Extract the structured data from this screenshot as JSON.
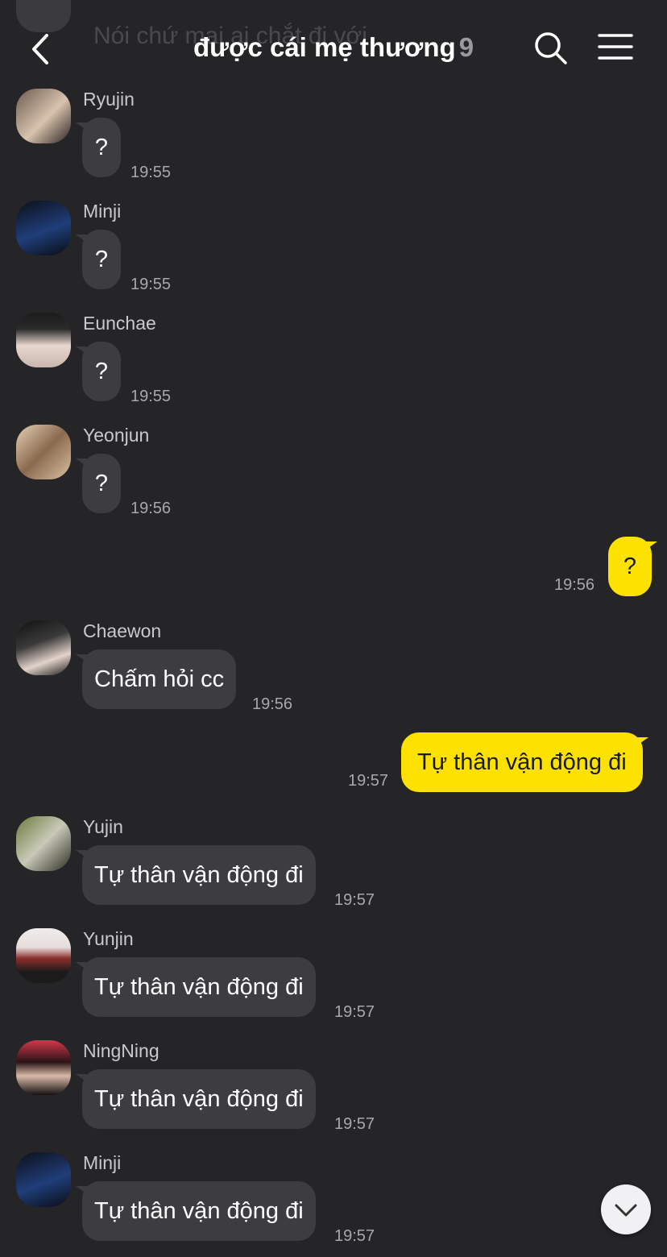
{
  "header": {
    "title": "được cái mẹ thương",
    "member_count": "9",
    "behind_preview": "Nói chứ mai ai chắt đi với"
  },
  "messages": [
    {
      "sender": "Ryujin",
      "text": "?",
      "time": "19:55",
      "avatar": "ryujin-avatar"
    },
    {
      "sender": "Minji",
      "text": "?",
      "time": "19:55",
      "avatar": "minji-avatar"
    },
    {
      "sender": "Eunchae",
      "text": "?",
      "time": "19:55",
      "avatar": "eunchae-avatar"
    },
    {
      "sender": "Yeonjun",
      "text": "?",
      "time": "19:56",
      "avatar": "yeonjun-avatar"
    },
    {
      "sender": "me",
      "text": "?",
      "time": "19:56"
    },
    {
      "sender": "Chaewon",
      "text": "Chấm hỏi cc",
      "time": "19:56",
      "avatar": "chaewon-avatar"
    },
    {
      "sender": "me",
      "text": "Tự thân vận động đi",
      "time": "19:57"
    },
    {
      "sender": "Yujin",
      "text": "Tự thân vận động đi",
      "time": "19:57",
      "avatar": "yujin-avatar"
    },
    {
      "sender": "Yunjin",
      "text": "Tự thân vận động đi",
      "time": "19:57",
      "avatar": "yunjin-avatar"
    },
    {
      "sender": "NingNing",
      "text": "Tự thân vận động đi",
      "time": "19:57",
      "avatar": "ningning-avatar"
    },
    {
      "sender": "Minji",
      "text": "Tự thân vận động đi",
      "time": "19:57",
      "avatar": "minji-avatar"
    }
  ],
  "icons": {
    "back": "chevron-left-icon",
    "search": "search-icon",
    "menu": "hamburger-menu-icon",
    "scroll_down": "chevron-down-icon"
  },
  "colors": {
    "background": "#252528",
    "incoming_bubble": "#3d3d41",
    "outgoing_bubble": "#fde100",
    "member_count": "#9a9a9e"
  }
}
